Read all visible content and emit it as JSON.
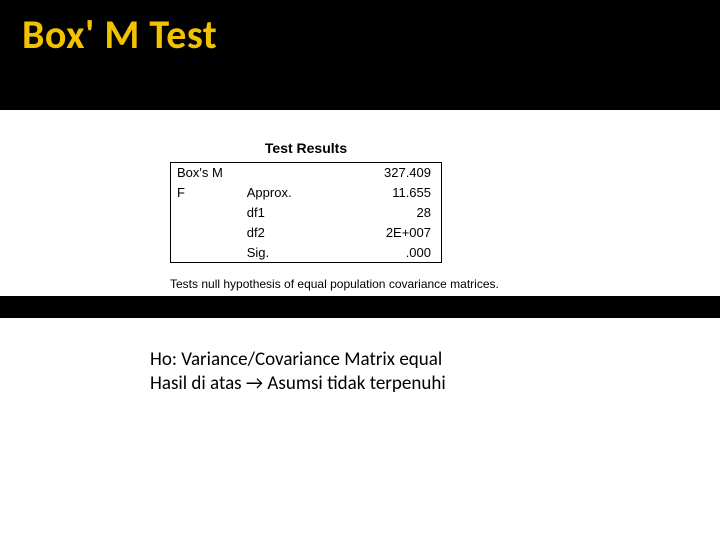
{
  "title": "Box' M Test",
  "table": {
    "title": "Test Results",
    "rows": [
      {
        "c1": "Box's M",
        "c2": "",
        "val": "327.409"
      },
      {
        "c1": "F",
        "c2": "Approx.",
        "val": "11.655"
      },
      {
        "c1": "",
        "c2": "df1",
        "val": "28"
      },
      {
        "c1": "",
        "c2": "df2",
        "val": "2E+007"
      },
      {
        "c1": "",
        "c2": "Sig.",
        "val": ".000"
      }
    ],
    "footnote": "Tests null hypothesis of equal population covariance matrices."
  },
  "notes": {
    "line1": "Ho: Variance/Covariance Matrix equal",
    "line2_a": "Hasil di atas ",
    "arrow": "→",
    "line2_b": " Asumsi tidak terpenuhi"
  }
}
